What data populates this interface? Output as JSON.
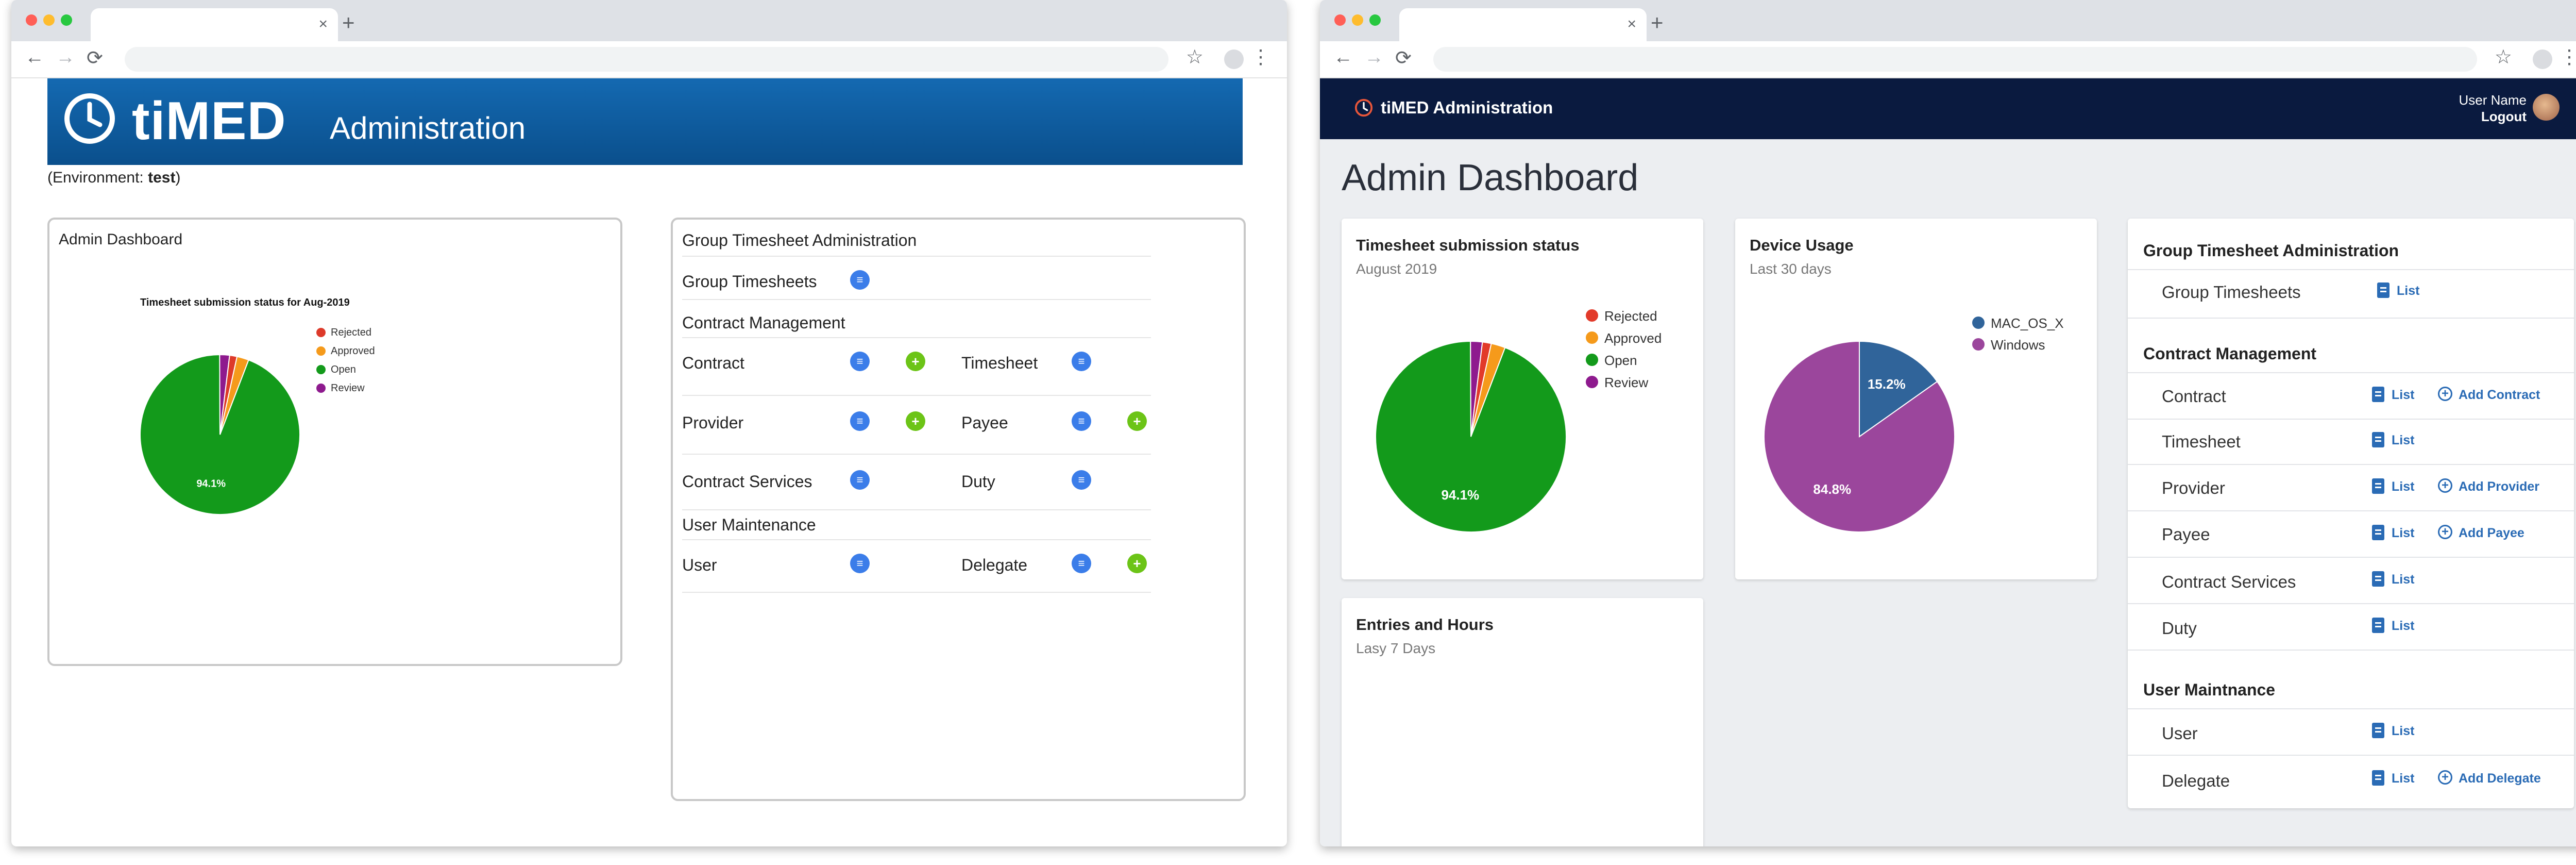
{
  "browser": {
    "tab_close": "×",
    "new_tab": "+",
    "back": "←",
    "forward": "→",
    "reload": "⟳",
    "star": "☆",
    "menu": "⋮"
  },
  "old": {
    "brand": "tiMED",
    "brand_suffix": "Administration",
    "environment_prefix": "(Environment: ",
    "environment_value": "test",
    "environment_suffix": ")",
    "dashboard_title": "Admin Dashboard",
    "chart_title": "Timesheet submission status for Aug-2019",
    "legend": [
      "Rejected",
      "Approved",
      "Open",
      "Review"
    ],
    "pct_label": "94.1%",
    "sections": {
      "group": "Group Timesheet Administration",
      "contract": "Contract Management",
      "user": "User Maintenance"
    },
    "items": {
      "group_timesheets": "Group Timesheets",
      "contract": "Contract",
      "timesheet": "Timesheet",
      "provider": "Provider",
      "payee": "Payee",
      "contract_services": "Contract Services",
      "duty": "Duty",
      "user": "User",
      "delegate": "Delegate"
    },
    "icon_list": "≡",
    "icon_add": "+"
  },
  "new": {
    "brand": "tiMED Administration",
    "user_name": "User Name",
    "logout": "Logout",
    "page_title": "Admin Dashboard",
    "card1": {
      "title": "Timesheet submission status",
      "subtitle": "August 2019",
      "legend": [
        "Rejected",
        "Approved",
        "Open",
        "Review"
      ],
      "pct_label": "94.1%"
    },
    "card2": {
      "title": "Device Usage",
      "subtitle": "Last 30 days",
      "legend": [
        "MAC_OS_X",
        "Windows"
      ],
      "mac_label": "15.2%",
      "win_label": "84.8%"
    },
    "card3": {
      "title": "Entries and Hours",
      "subtitle": "Lasy 7 Days"
    },
    "panel": {
      "sec_group": "Group Timesheet Administration",
      "sec_contract": "Contract Management",
      "sec_user": "User Maintnance",
      "list": "List",
      "rows": {
        "group_timesheets": "Group Timesheets",
        "contract": "Contract",
        "timesheet": "Timesheet",
        "provider": "Provider",
        "payee": "Payee",
        "contract_services": "Contract Services",
        "duty": "Duty",
        "user": "User",
        "delegate": "Delegate"
      },
      "add": {
        "contract": "Add Contract",
        "provider": "Add Provider",
        "payee": "Add Payee",
        "delegate": "Add Delegate"
      }
    }
  },
  "chart_data": [
    {
      "type": "pie",
      "title": "Timesheet submission status for Aug-2019",
      "labels": [
        "Rejected",
        "Approved",
        "Open",
        "Review"
      ],
      "values": [
        1.5,
        2.4,
        94.1,
        2.0
      ],
      "colors": [
        "#dd3a2a",
        "#f59a1b",
        "#139a1b",
        "#8e1a8e"
      ],
      "legend": "right"
    },
    {
      "type": "pie",
      "title": "Timesheet submission status",
      "subtitle": "August 2019",
      "labels": [
        "Rejected",
        "Approved",
        "Open",
        "Review"
      ],
      "values": [
        1.5,
        2.4,
        94.1,
        2.0
      ],
      "colors": [
        "#e23a2a",
        "#f59a1b",
        "#139a1b",
        "#8e1a8e"
      ],
      "legend": "right"
    },
    {
      "type": "pie",
      "title": "Device Usage",
      "subtitle": "Last 30 days",
      "labels": [
        "MAC_OS_X",
        "Windows"
      ],
      "values": [
        15.2,
        84.8
      ],
      "colors": [
        "#30649a",
        "#9b469c"
      ],
      "legend": "right"
    }
  ]
}
